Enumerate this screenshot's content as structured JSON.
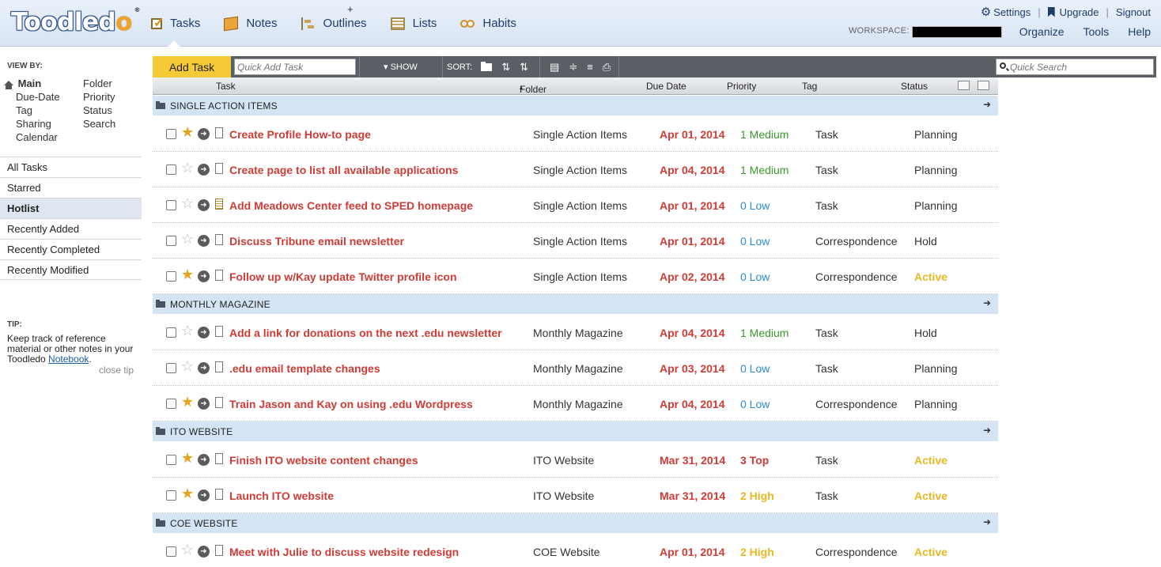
{
  "app": {
    "logo_text": "Toodled",
    "logo_check": "o",
    "logo_reg": "®"
  },
  "nav": [
    {
      "label": "Tasks",
      "icon": "tasks-icon"
    },
    {
      "label": "Notes",
      "icon": "notes-icon"
    },
    {
      "label": "Outlines",
      "icon": "outlines-icon"
    },
    {
      "label": "Lists",
      "icon": "lists-icon"
    },
    {
      "label": "Habits",
      "icon": "habits-icon"
    }
  ],
  "top_links": {
    "settings": "Settings",
    "upgrade": "Upgrade",
    "signout": "Signout",
    "sep": "|"
  },
  "workspace_label": "WORKSPACE:",
  "sub_menu": [
    "Organize",
    "Tools",
    "Help"
  ],
  "sidebar": {
    "viewby_title": "VIEW BY:",
    "viewby_left": [
      "Main",
      "Due-Date",
      "Tag",
      "Sharing",
      "Calendar"
    ],
    "viewby_right": [
      "Folder",
      "Priority",
      "Status",
      "Search"
    ],
    "lists": [
      "All Tasks",
      "Starred",
      "Hotlist",
      "Recently Added",
      "Recently Completed",
      "Recently Modified"
    ],
    "active_list": "Hotlist",
    "tip_title": "TIP:",
    "tip_text": "Keep track of reference material or other notes in your Toodledo ",
    "tip_link": "Notebook",
    "tip_end": ".",
    "close_tip": "close tip"
  },
  "toolbar": {
    "add_task": "Add Task",
    "quick_add_placeholder": "Quick Add Task",
    "quick_add_plus": "+",
    "show": "▾ SHOW",
    "sort": "SORT:",
    "quick_search_placeholder": "Quick Search"
  },
  "columns": {
    "task": "Task",
    "folder": "Folder",
    "folder_sort": "▴",
    "due": "Due Date",
    "priority": "Priority",
    "tag": "Tag",
    "status": "Status"
  },
  "groups": [
    {
      "name": "SINGLE ACTION ITEMS",
      "tasks": [
        {
          "title": "Create Profile How-to page",
          "starred": true,
          "note": false,
          "folder": "Single Action Items",
          "due": "Apr 01, 2014",
          "priority": "1 Medium",
          "tag": "Task",
          "status": "Planning"
        },
        {
          "title": "Create page to list all available applications",
          "starred": false,
          "note": false,
          "folder": "Single Action Items",
          "due": "Apr 04, 2014",
          "priority": "1 Medium",
          "tag": "Task",
          "status": "Planning"
        },
        {
          "title": "Add Meadows Center feed to SPED homepage",
          "starred": false,
          "note": true,
          "folder": "Single Action Items",
          "due": "Apr 01, 2014",
          "priority": "0 Low",
          "tag": "Task",
          "status": "Planning"
        },
        {
          "title": "Discuss Tribune email newsletter",
          "starred": false,
          "note": false,
          "folder": "Single Action Items",
          "due": "Apr 01, 2014",
          "priority": "0 Low",
          "tag": "Correspondence",
          "status": "Hold"
        },
        {
          "title": "Follow up w/Kay update Twitter profile icon",
          "starred": true,
          "note": false,
          "folder": "Single Action Items",
          "due": "Apr 02, 2014",
          "priority": "0 Low",
          "tag": "Correspondence",
          "status": "Active"
        }
      ]
    },
    {
      "name": "MONTHLY MAGAZINE",
      "tasks": [
        {
          "title": "Add a link for donations on the next .edu newsletter",
          "starred": false,
          "note": false,
          "folder": "Monthly Magazine",
          "due": "Apr 04, 2014",
          "priority": "1 Medium",
          "tag": "Task",
          "status": "Hold"
        },
        {
          "title": ".edu email template changes",
          "starred": false,
          "note": false,
          "folder": "Monthly Magazine",
          "due": "Apr 03, 2014",
          "priority": "0 Low",
          "tag": "Task",
          "status": "Planning"
        },
        {
          "title": "Train Jason and Kay on using .edu Wordpress",
          "starred": true,
          "note": false,
          "folder": "Monthly Magazine",
          "due": "Apr 04, 2014",
          "priority": "0 Low",
          "tag": "Correspondence",
          "status": "Planning"
        }
      ]
    },
    {
      "name": "ITO WEBSITE",
      "tasks": [
        {
          "title": "Finish ITO website content changes",
          "starred": true,
          "note": false,
          "folder": "ITO Website",
          "due": "Mar 31, 2014",
          "priority": "3 Top",
          "tag": "Task",
          "status": "Active"
        },
        {
          "title": "Launch ITO website",
          "starred": true,
          "note": false,
          "folder": "ITO Website",
          "due": "Mar 31, 2014",
          "priority": "2 High",
          "tag": "Task",
          "status": "Active"
        }
      ]
    },
    {
      "name": "COE WEBSITE",
      "tasks": [
        {
          "title": "Meet with Julie to discuss website redesign",
          "starred": false,
          "note": false,
          "folder": "COE Website",
          "due": "Apr 01, 2014",
          "priority": "2 High",
          "tag": "Correspondence",
          "status": "Active"
        }
      ]
    }
  ],
  "colors": {
    "accent": "#f6c936",
    "task_red": "#d13b36",
    "medium": "#3a9a2a",
    "low": "#2e8bd6",
    "high": "#e8b824"
  }
}
